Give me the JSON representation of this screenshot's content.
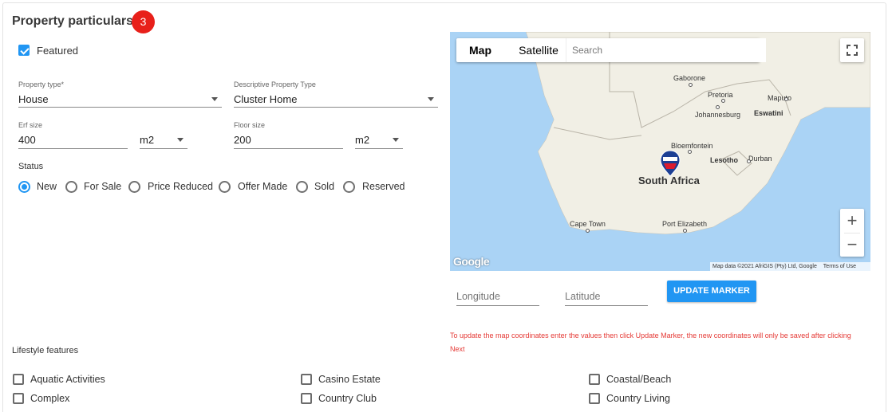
{
  "section": {
    "title": "Property particulars",
    "badge": "3"
  },
  "featured": {
    "label": "Featured",
    "checked": true
  },
  "property_type": {
    "label": "Property type*",
    "value": "House"
  },
  "descriptive_type": {
    "label": "Descriptive Property Type",
    "value": "Cluster Home"
  },
  "erf_size": {
    "label": "Erf size",
    "value": "400",
    "unit": "m2"
  },
  "floor_size": {
    "label": "Floor size",
    "value": "200",
    "unit": "m2"
  },
  "status": {
    "label": "Status",
    "options": [
      "New",
      "For Sale",
      "Price Reduced",
      "Offer Made",
      "Sold",
      "Reserved"
    ],
    "selected": "New"
  },
  "map": {
    "tabs": [
      "Map",
      "Satellite"
    ],
    "selected_tab": "Map",
    "search_placeholder": "Search",
    "country_label": "South Africa",
    "places": [
      "Gaborone",
      "Pretoria",
      "Maputo",
      "Johannesburg",
      "Eswatini",
      "Bloemfontein",
      "Lesotho",
      "Durban",
      "Cape Town",
      "Port Elizabeth"
    ],
    "google_logo": "Google",
    "attribution": "Map data ©2021 AfriGIS (Pty) Ltd, Google",
    "terms": "Terms of Use",
    "zoom_in": "+",
    "zoom_out": "−",
    "marker_text": "RE/MAX"
  },
  "coords": {
    "longitude_placeholder": "Longitude",
    "latitude_placeholder": "Latitude",
    "update_label": "UPDATE MARKER",
    "hint": "To update the map coordinates enter the values then click Update Marker, the new coordinates will only be saved after clicking Next"
  },
  "lifestyle": {
    "title": "Lifestyle features",
    "items": [
      "Aquatic Activities",
      "Casino Estate",
      "Coastal/Beach",
      "Complex",
      "Country Club",
      "Country Living"
    ]
  },
  "colors": {
    "accent": "#2196f3",
    "badge": "#e8201a",
    "hint": "#e53935",
    "water": "#aad3f5",
    "land": "#f1efe5"
  }
}
